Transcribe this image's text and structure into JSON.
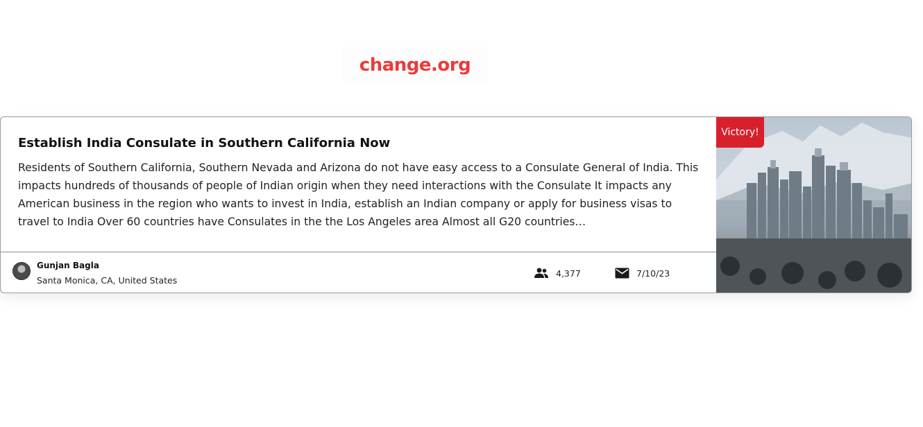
{
  "logo": {
    "text": "change.org",
    "color": "#ec3b3b"
  },
  "petition": {
    "title": "Establish India Consulate in Southern California Now",
    "description": "Residents  of Southern California, Southern Nevada and Arizona do not have easy access to a Consulate General of India.  This impacts hundreds of thousands of people of Indian origin when they need interactions with the Consulate It impacts any American business in the region who wants to invest in India, establish an Indian company or apply for business visas to travel to India Over 60 countries have Consulates in the the Los Angeles area Almost all G20 countries…",
    "badge": "Victory!",
    "badge_color": "#d8202c",
    "author": {
      "name": "Gunjan Bagla",
      "location": "Santa Monica, CA, United States"
    },
    "signers_icon": "people-icon",
    "signers": "4,377",
    "date_icon": "envelope-icon",
    "date": "7/10/23",
    "image": "city-skyline-image"
  }
}
